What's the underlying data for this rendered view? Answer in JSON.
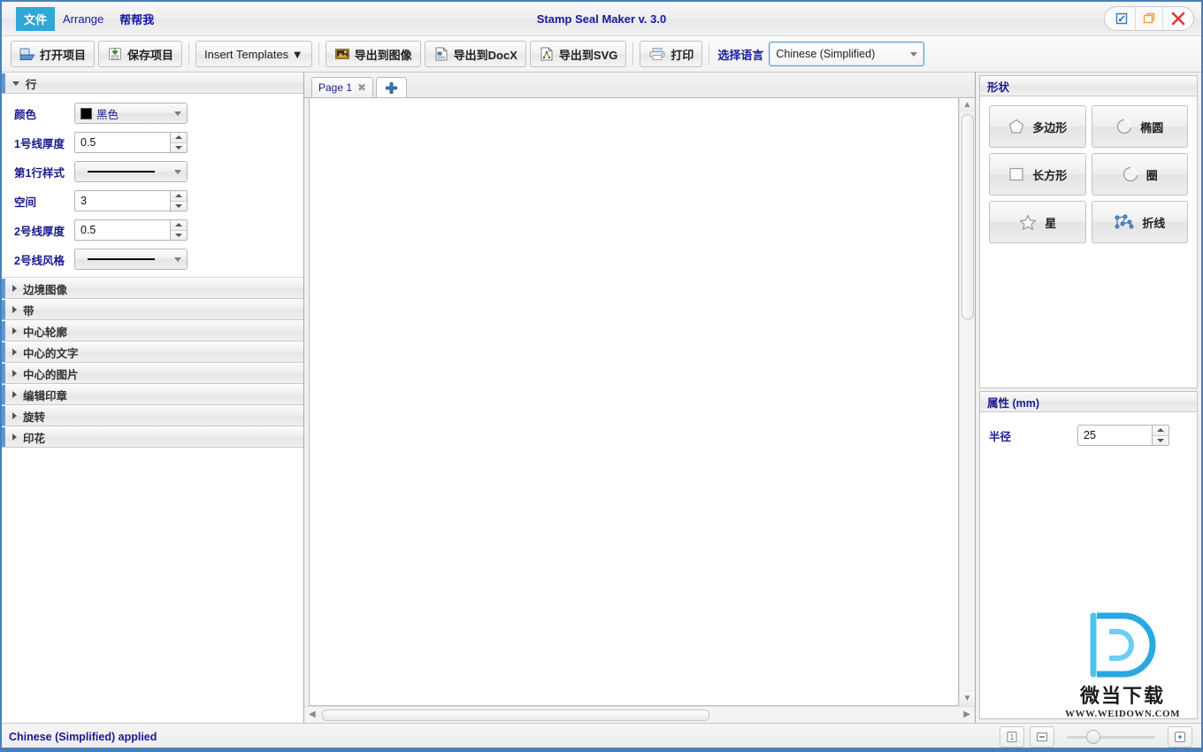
{
  "window": {
    "title": "Stamp Seal Maker v. 3.0",
    "controls": [
      {
        "name": "minimize-button",
        "icon": "minimize-arrow-icon"
      },
      {
        "name": "maximize-button",
        "icon": "restore-window-icon"
      },
      {
        "name": "close-button",
        "icon": "close-x-icon"
      }
    ]
  },
  "menubar": {
    "items": [
      {
        "label": "文件",
        "active": true
      },
      {
        "label": "Arrange",
        "active": false
      },
      {
        "label": "帮帮我",
        "active": false
      }
    ]
  },
  "toolbar": {
    "open_project": "打开项目",
    "save_project": "保存项目",
    "insert_templates": "Insert Templates ▼",
    "export_image": "导出到图像",
    "export_docx": "导出到DocX",
    "export_svg": "导出到SVG",
    "print": "打印",
    "language_label": "选择语言",
    "language_value": "Chinese (Simplified)"
  },
  "left_panel": {
    "open_section": {
      "title": "行",
      "expanded": true,
      "fields": {
        "color_label": "颜色",
        "color_value": "黑色",
        "color_hex": "#000000",
        "line1_thickness_label": "1号线厚度",
        "line1_thickness_value": "0.5",
        "line1_style_label": "第1行样式",
        "line1_style_value": "solid-line",
        "space_label": "空间",
        "space_value": "3",
        "line2_thickness_label": "2号线厚度",
        "line2_thickness_value": "0.5",
        "line2_style_label": "2号线风格",
        "line2_style_value": "solid-line"
      }
    },
    "collapsed_sections": [
      {
        "label": "边境图像"
      },
      {
        "label": "带"
      },
      {
        "label": "中心轮廓"
      },
      {
        "label": "中心的文字"
      },
      {
        "label": "中心的图片"
      },
      {
        "label": "编辑印章"
      },
      {
        "label": "旋转"
      },
      {
        "label": "印花"
      }
    ]
  },
  "center": {
    "tabs": [
      {
        "label": "Page 1",
        "closable": true
      }
    ],
    "add_tab_icon": "plus-icon"
  },
  "right_panel": {
    "shapes": {
      "title": "形状",
      "buttons": [
        {
          "label": "多边形",
          "icon": "pentagon-icon"
        },
        {
          "label": "椭圆",
          "icon": "ellipse-icon"
        },
        {
          "label": "长方形",
          "icon": "rectangle-icon"
        },
        {
          "label": "圈",
          "icon": "circle-icon"
        },
        {
          "label": "星",
          "icon": "star-icon"
        },
        {
          "label": "折线",
          "icon": "polyline-icon"
        }
      ]
    },
    "properties": {
      "title": "属性 (mm)",
      "radius_label": "半径",
      "radius_value": "25"
    },
    "watermark": {
      "logo": "D",
      "text": "微当下载",
      "url": "WWW.WEIDOWN.COM",
      "color": "#2fb0e8"
    }
  },
  "statusbar": {
    "message": "Chinese (Simplified) applied",
    "buttons": [
      {
        "name": "actual-size-button",
        "icon": "page-one-icon"
      },
      {
        "name": "fit-page-button",
        "icon": "fit-window-icon"
      },
      {
        "name": "zoom-reset-button",
        "icon": "zoom-plus-icon"
      }
    ],
    "zoom_slider_value": 22
  },
  "colors": {
    "accent": "#4a7ebb",
    "menu_highlight": "#2fa8d8",
    "label_blue": "#1a1a8c",
    "panel_accent": "#5b9bd5"
  }
}
